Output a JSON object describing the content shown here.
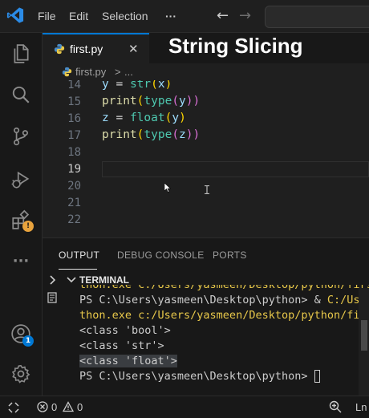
{
  "titlebar": {
    "menu": [
      "File",
      "Edit",
      "Selection"
    ],
    "more": "···",
    "back_arrow": "←",
    "forward_arrow": "→"
  },
  "overlay_title": "String Slicing",
  "tab": {
    "label": "first.py",
    "close": "✕"
  },
  "breadcrumb": {
    "file": "first.py",
    "sep": ">",
    "rest": "..."
  },
  "editor": {
    "line_numbers": [
      "14",
      "15",
      "16",
      "17",
      "18",
      "19",
      "20",
      "21",
      "22"
    ],
    "code": {
      "l14_a": "y",
      "l14_b": " = ",
      "l14_c": "str",
      "l14_d": "(",
      "l14_e": "x",
      "l14_f": ")",
      "l15_a": "print",
      "l15_b": "(",
      "l15_c": "type",
      "l15_d": "(",
      "l15_e": "y",
      "l15_f": "))",
      "l16_a": "z",
      "l16_b": " = ",
      "l16_c": "float",
      "l16_d": "(",
      "l16_e": "y",
      "l16_f": ")",
      "l17_a": "print",
      "l17_b": "(",
      "l17_c": "type",
      "l17_d": "(",
      "l17_e": "z",
      "l17_f": "))"
    }
  },
  "panel": {
    "tabs": [
      "OUTPUT",
      "DEBUG CONSOLE",
      "PORTS"
    ],
    "terminal_title": "TERMINAL",
    "lines": [
      "thon.exe c:/Users/yasmeen/Desktop/python/firs",
      "PS C:\\Users\\yasmeen\\Desktop\\python> & C:/User",
      "thon.exe c:/Users/yasmeen/Desktop/python/firs",
      "<class 'bool'>",
      "<class 'str'>",
      "<class 'float'>",
      "PS C:\\Users\\yasmeen\\Desktop\\python> "
    ]
  },
  "activity": {
    "accounts_badge": "1"
  },
  "status": {
    "errors": "0",
    "warnings": "0",
    "ln": "Ln"
  },
  "colors": {
    "accent": "#0078d4",
    "badge_warning": "#e8a33d",
    "vscode_blue": "#2b8be6"
  }
}
